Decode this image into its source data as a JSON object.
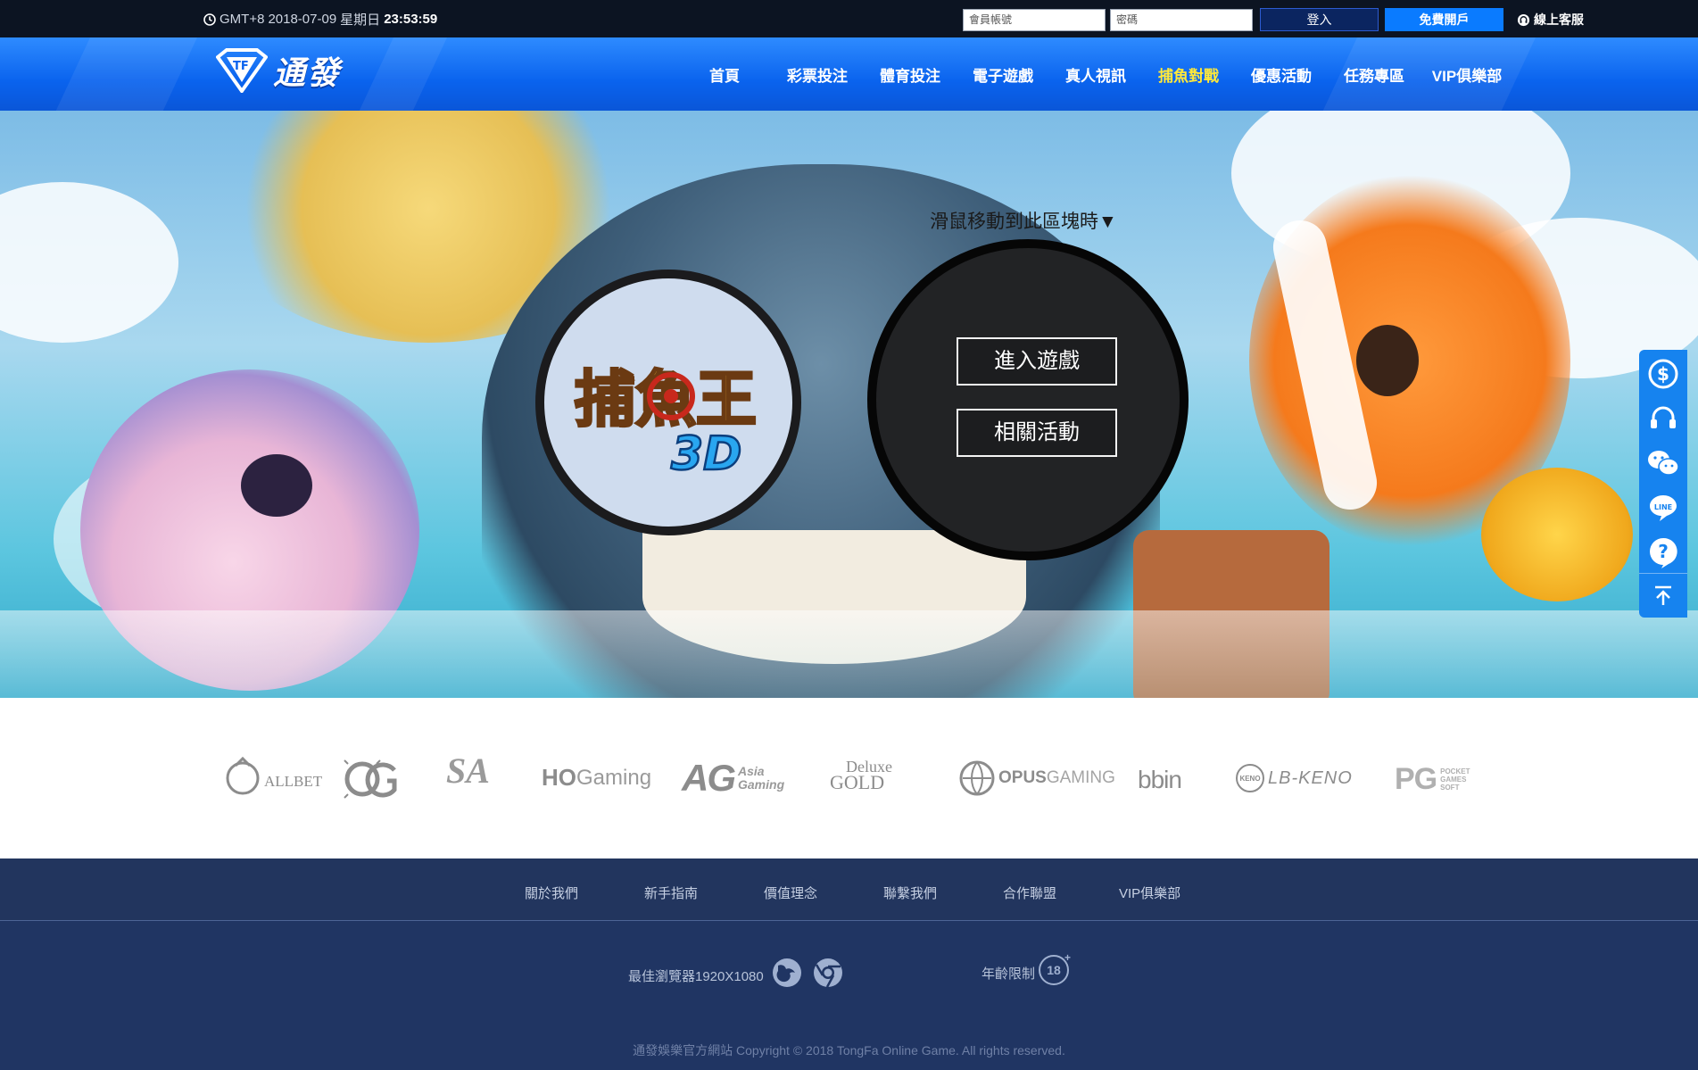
{
  "topbar": {
    "tz": "GMT+8",
    "date": "2018-07-09",
    "weekday": "星期日",
    "time": "23:53:59",
    "username_placeholder": "會員帳號",
    "password_placeholder": "密碼",
    "login_label": "登入",
    "register_label": "免費開戶",
    "support_label": "線上客服"
  },
  "brand": {
    "logo_text": "通發",
    "accent": "#0a63ee",
    "active_color": "#ffe93a"
  },
  "nav": {
    "items": [
      {
        "label": "首頁"
      },
      {
        "label": "彩票投注"
      },
      {
        "label": "體育投注"
      },
      {
        "label": "電子遊戲"
      },
      {
        "label": "真人視訊"
      },
      {
        "label": "捕魚對戰",
        "active": true
      },
      {
        "label": "優惠活動"
      },
      {
        "label": "任務專區"
      },
      {
        "label": "VIP俱樂部"
      }
    ]
  },
  "banner": {
    "hint": "滑鼠移動到此區塊時▼",
    "game_logo_text": "捕魚王",
    "game_logo_sub": "3D",
    "enter_label": "進入遊戲",
    "related_label": "相關活動"
  },
  "side_dock": {
    "items": [
      "dollar-icon",
      "headset-icon",
      "wechat-icon",
      "line-icon",
      "help-icon",
      "back-to-top-icon"
    ],
    "line_text": "LINE"
  },
  "partners": {
    "allbet": "ALLBET",
    "og": "OG",
    "sa": "SA",
    "ho": "HO",
    "ho_rest": "Gaming",
    "ag": "AG",
    "ag_sub1": "Asia",
    "ag_sub2": "Gaming",
    "deluxe": "Deluxe",
    "deluxe_gold": "GOLD",
    "opus": "OPUS",
    "opus_rest": "GAMING",
    "bbin": "bbin",
    "keno_badge": "KENO",
    "lbkeno": "LB-KENO",
    "pg": "PG",
    "pg_sub1": "POCKET",
    "pg_sub2": "GAMES",
    "pg_sub3": "SOFT"
  },
  "footer": {
    "links": [
      "關於我們",
      "新手指南",
      "價值理念",
      "聯繫我們",
      "合作聯盟",
      "VIP俱樂部"
    ],
    "browser_text": "最佳瀏覽器1920X1080",
    "age_text": "年齡限制",
    "age_badge": "18",
    "copyright": "通發娛樂官方網站 Copyright © 2018 TongFa Online Game. All rights reserved."
  }
}
